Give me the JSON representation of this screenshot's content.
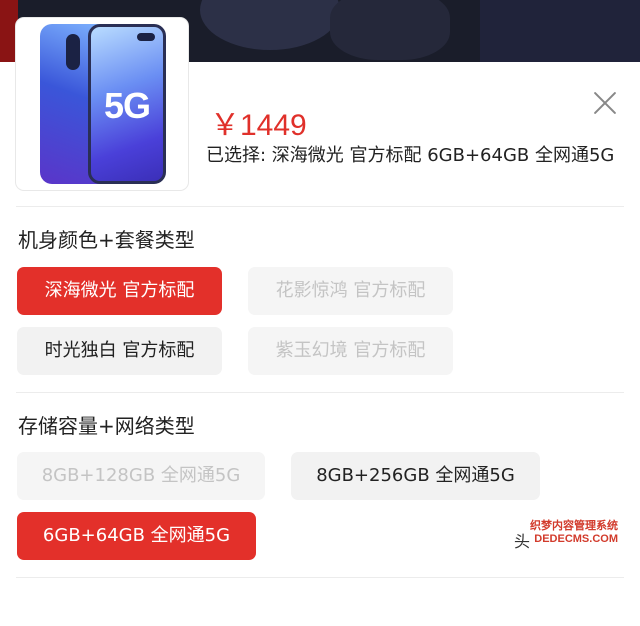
{
  "product": {
    "price": "￥1449",
    "selected_text": "已选择: 深海微光 官方标配 6GB+64GB 全网通5G",
    "image_label": "5G",
    "image_icon": "phone-product-image"
  },
  "color_section": {
    "title": "机身颜色+套餐类型",
    "options": [
      {
        "label": "深海微光 官方标配",
        "state": "selected"
      },
      {
        "label": "花影惊鸿 官方标配",
        "state": "disabled"
      },
      {
        "label": "时光独白 官方标配",
        "state": "normal"
      },
      {
        "label": "紫玉幻境 官方标配",
        "state": "disabled"
      }
    ]
  },
  "storage_section": {
    "title": "存储容量+网络类型",
    "options": [
      {
        "label": "8GB+128GB 全网通5G",
        "state": "disabled"
      },
      {
        "label": "8GB+256GB 全网通5G",
        "state": "normal"
      },
      {
        "label": "6GB+64GB 全网通5G",
        "state": "selected"
      }
    ]
  },
  "close_icon": "close-icon",
  "watermark": {
    "partial": "头",
    "line1": "织梦内容管理系统",
    "line2": "DEDECMS.COM"
  },
  "colors": {
    "accent": "#e3302a",
    "price": "#e0302a",
    "option_bg": "#f2f2f2",
    "disabled_text": "#c4c4c4"
  }
}
